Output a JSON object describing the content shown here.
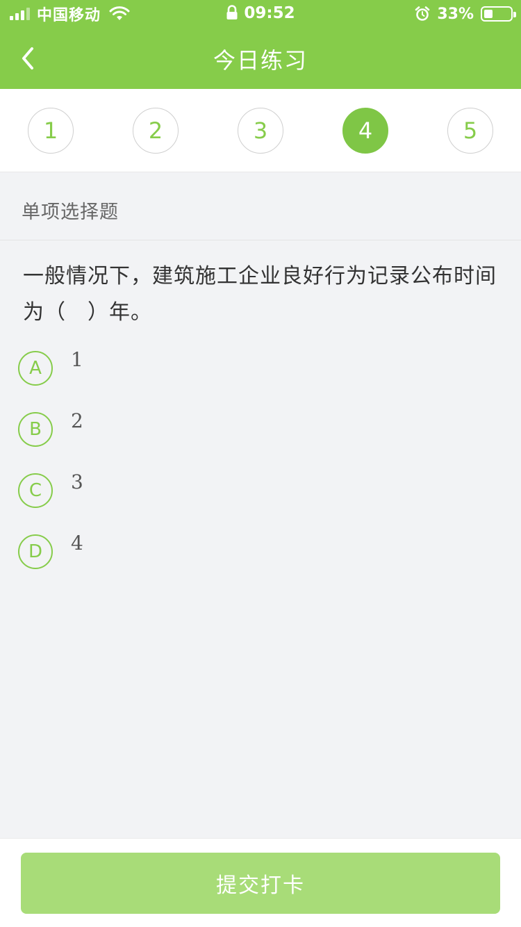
{
  "status_bar": {
    "carrier": "中国移动",
    "time": "09:52",
    "battery": "33%",
    "battery_level": 0.33
  },
  "header": {
    "title": "今日练习",
    "back_icon": "chevron-left-icon"
  },
  "question_nav": {
    "items": [
      "1",
      "2",
      "3",
      "4",
      "5"
    ],
    "active_index": 3
  },
  "question": {
    "type": "单项选择题",
    "text": "一般情况下，建筑施工企业良好行为记录公布时间为（　）年。",
    "options": [
      {
        "letter": "A",
        "text": "1"
      },
      {
        "letter": "B",
        "text": "2"
      },
      {
        "letter": "C",
        "text": "3"
      },
      {
        "letter": "D",
        "text": "4"
      }
    ]
  },
  "footer": {
    "submit_label": "提交打卡"
  },
  "colors": {
    "brand_green": "#86cc4a",
    "active_green": "#7fc646",
    "submit_bg": "#a8dc78",
    "page_bg": "#f2f3f5"
  }
}
